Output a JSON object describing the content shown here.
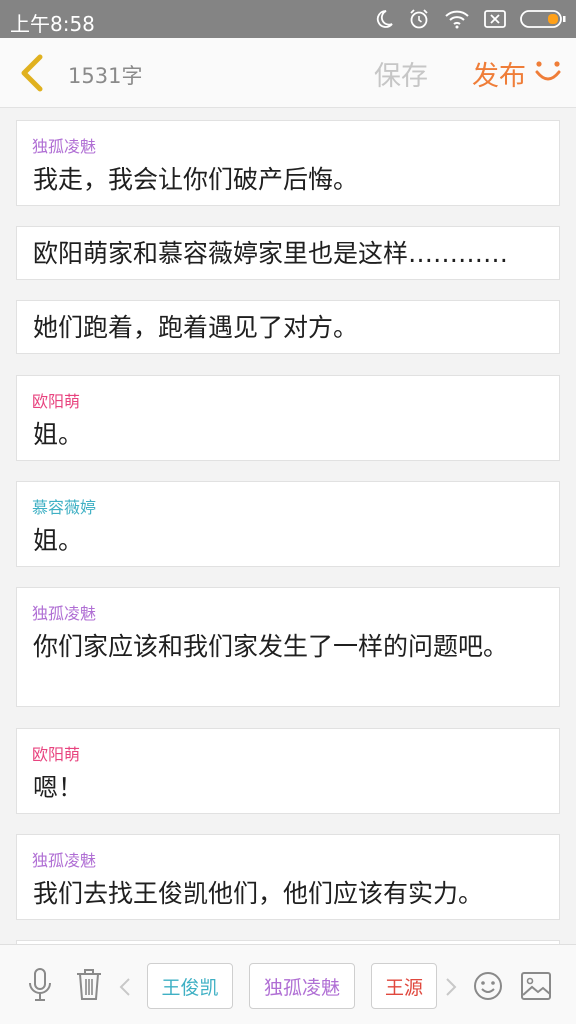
{
  "status_bar": {
    "time": "上午8:58",
    "icons": [
      "moon-icon",
      "alarm-icon",
      "wifi-icon",
      "sim-x-icon",
      "battery-icon"
    ]
  },
  "header": {
    "word_count": "1531字",
    "save_label": "保存",
    "publish_label": "发布",
    "publish_color": "#ef7d38"
  },
  "messages": [
    {
      "speaker": "独孤凌魅",
      "speaker_color": "#b06fd4",
      "text": "我走，我会让你们破产后悔。"
    },
    {
      "speaker": "",
      "text": "欧阳萌家和慕容薇婷家里也是这样…………"
    },
    {
      "speaker": "",
      "text": "她们跑着，跑着遇见了对方。"
    },
    {
      "speaker": "欧阳萌",
      "speaker_color": "#e8447f",
      "text": "姐。"
    },
    {
      "speaker": "慕容薇婷",
      "speaker_color": "#3fb0c4",
      "text": "姐。"
    },
    {
      "speaker": "独孤凌魅",
      "speaker_color": "#b06fd4",
      "text": "你们家应该和我们家发生了一样的问题吧。"
    },
    {
      "speaker": "欧阳萌",
      "speaker_color": "#e8447f",
      "text": "嗯！"
    },
    {
      "speaker": "独孤凌魅",
      "speaker_color": "#b06fd4",
      "text": "我们去找王俊凯他们，他们应该有实力。"
    }
  ],
  "toolbar": {
    "characters": [
      {
        "label": "王俊凯",
        "color": "#3fb0c4"
      },
      {
        "label": "独孤凌魅",
        "color": "#b06fd4"
      },
      {
        "label": "王源",
        "color": "#e0483e"
      }
    ],
    "icons": [
      "microphone-icon",
      "trash-icon",
      "chevron-left-icon",
      "chevron-right-icon",
      "emoji-icon",
      "image-icon"
    ]
  }
}
